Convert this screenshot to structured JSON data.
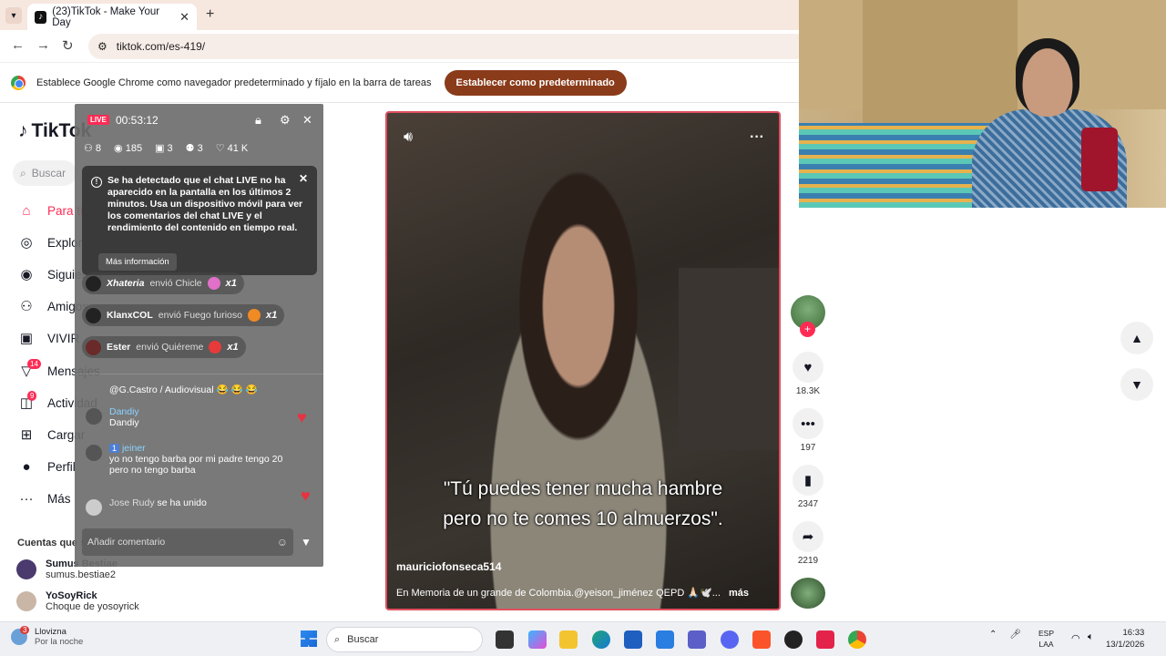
{
  "browser": {
    "tab_title": "(23)TikTok - Make Your Day",
    "url": "tiktok.com/es-419/",
    "new_tab": "+",
    "infobar_text": "Establece Google Chrome como navegador predeterminado y fíjalo en la barra de tareas",
    "infobar_button": "Establecer como predeterminado"
  },
  "sidebar": {
    "logo": "TikTok",
    "search_placeholder": "Buscar",
    "items": [
      {
        "label": "Para ti",
        "icon": "home-icon"
      },
      {
        "label": "Explorar",
        "icon": "compass-icon"
      },
      {
        "label": "Siguiendo",
        "icon": "following-icon"
      },
      {
        "label": "Amigos",
        "icon": "friends-icon"
      },
      {
        "label": "VIVIR",
        "icon": "live-icon"
      },
      {
        "label": "Mensajes",
        "icon": "messages-icon",
        "badge": "14"
      },
      {
        "label": "Actividad",
        "icon": "activity-icon",
        "badge": "9"
      },
      {
        "label": "Cargar",
        "icon": "upload-icon"
      },
      {
        "label": "Perfil",
        "icon": "profile-icon"
      },
      {
        "label": "Más",
        "icon": "more-icon"
      }
    ],
    "following_title": "Cuentas que sigues",
    "accounts": [
      {
        "name": "Sumus Bestiae",
        "handle": "sumus.bestiae2"
      },
      {
        "name": "YoSoyRick",
        "handle": "Choque de yosoyrick"
      }
    ]
  },
  "live": {
    "badge": "LIVE",
    "time": "00:53:12",
    "stats": {
      "people": "8",
      "views": "185",
      "gifts": "3",
      "users": "3",
      "likes": "41 K"
    },
    "notice": "Se ha detectado que el chat LIVE no ha aparecido en la pantalla en los últimos 2 minutos. Usa un dispositivo móvil para ver los comentarios del chat LIVE y el rendimiento del contenido en tiempo real.",
    "notice_more": "Más información",
    "gifts": [
      {
        "user": "Xhateria",
        "text": "envió Chicle",
        "count": "x1",
        "color": "#e070c8"
      },
      {
        "user": "KlanxCOL",
        "text": "envió Fuego furioso",
        "count": "x1",
        "color": "#f08a24"
      },
      {
        "user": "Ester",
        "text": "envió Quiéreme",
        "count": "x1",
        "color": "#e83a3a"
      }
    ],
    "comments": [
      {
        "user": "",
        "text": "@G.Castro / Audiovisual 😂 😂 😂"
      },
      {
        "user": "Dandiy",
        "text": "Dandiy"
      },
      {
        "user": "jeiner",
        "level": "1",
        "text": "yo no tengo barba por mi padre tengo 20 pero no tengo barba"
      },
      {
        "user": "Jose Rudy",
        "text": "se ha unido"
      }
    ],
    "input_placeholder": "Añadir comentario"
  },
  "video": {
    "subtitle_line1": "\"Tú puedes tener mucha hambre",
    "subtitle_line2": "pero no te comes 10 almuerzos\".",
    "author": "mauriciofonseca514",
    "description": "En Memoria de un grande de Colombia.@yeison_jiménez  QEPD 🙏🏻🕊️...",
    "more": "más"
  },
  "actions": {
    "likes": "18.3K",
    "comments": "197",
    "saves": "2347",
    "shares": "2219"
  },
  "taskbar": {
    "weather_title": "Llovizna",
    "weather_sub": "Por la noche",
    "weather_badge": "3",
    "search": "Buscar",
    "lang_line1": "ESP",
    "lang_line2": "LAA",
    "time": "16:33",
    "date": "13/1/2026"
  }
}
